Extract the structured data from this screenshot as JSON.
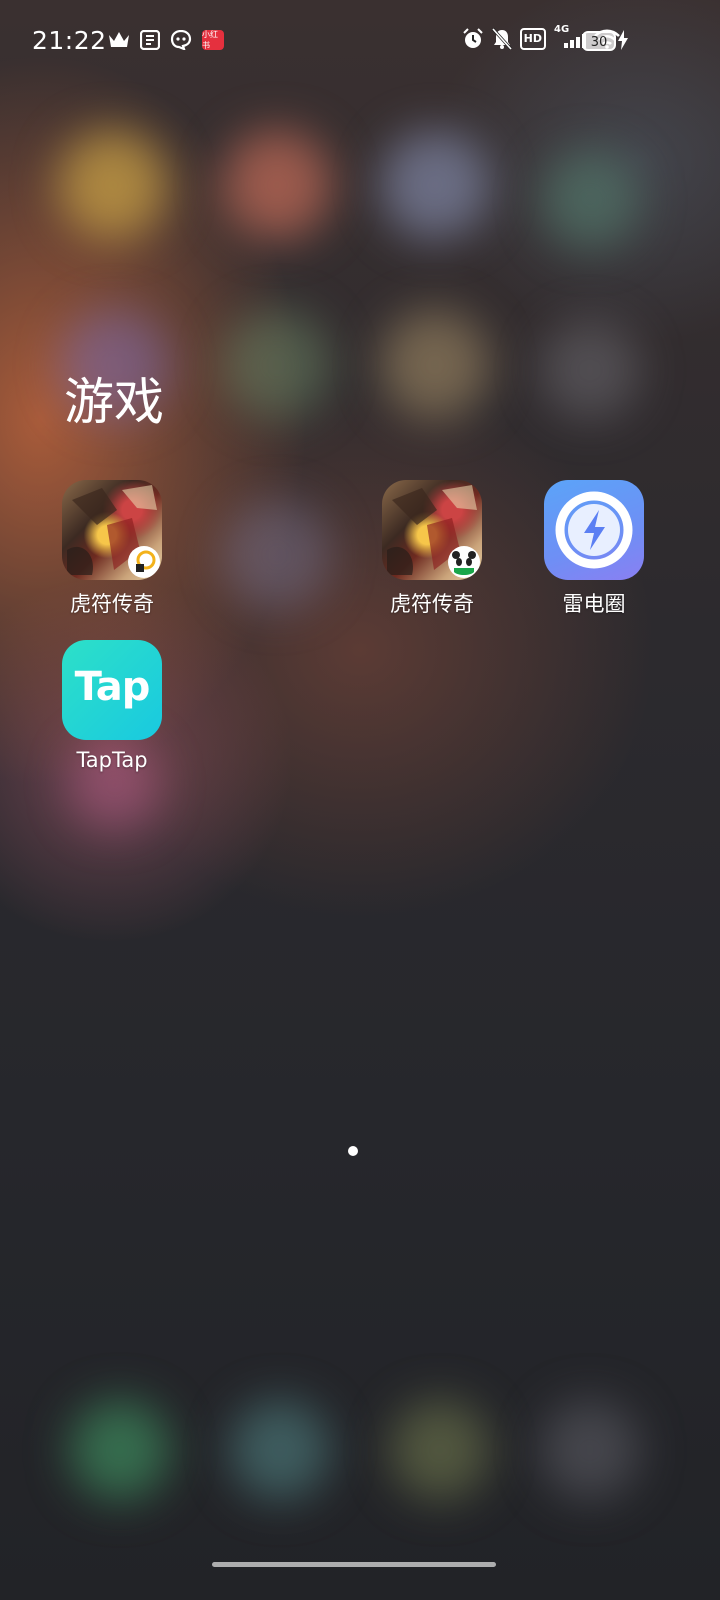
{
  "status_bar": {
    "time": "21:22",
    "notification_icons": [
      "crown-icon",
      "book-app-icon",
      "chat-bubble-icon",
      "red-app-icon"
    ],
    "red_app_text": "小红书",
    "system_icons": [
      "alarm-icon",
      "mute-bell-icon",
      "hd-icon",
      "signal-4g-icon",
      "wifi-icon"
    ],
    "hd_label": "HD",
    "network_label": "4G",
    "battery_level": "30",
    "charging": true
  },
  "folder": {
    "title": "游戏",
    "apps": [
      {
        "label": "虎符传奇",
        "icon": "game-dragon-icon",
        "badge": "yellow-p-badge"
      },
      {
        "label": "虎符传奇",
        "icon": "game-dragon-icon",
        "badge": "panda-badge"
      },
      {
        "label": "雷电圈",
        "icon": "lightning-ring-icon"
      },
      {
        "label": "TapTap",
        "icon": "taptap-icon",
        "icon_text": "Tap"
      }
    ]
  },
  "pager": {
    "pages": 1,
    "current": 1
  },
  "colors": {
    "taptap": "#19d0d6",
    "leidian": "#6e8ff5",
    "red_app": "#e5303e"
  }
}
